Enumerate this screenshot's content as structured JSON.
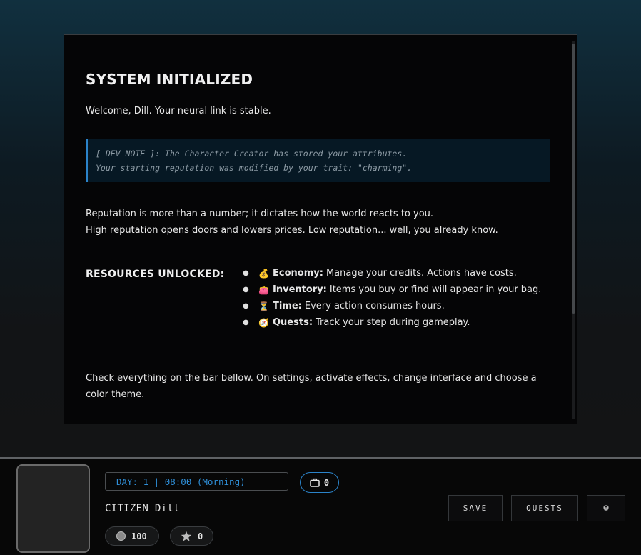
{
  "story": {
    "title": "SYSTEM INITIALIZED",
    "welcome": "Welcome, Dill. Your neural link is stable.",
    "dev_note": {
      "line1": "[ DEV NOTE ]: The Character Creator has stored your attributes.",
      "line2": "Your starting reputation was modified by your trait: \"charming\"."
    },
    "reputation": {
      "line1": "Reputation is more than a number; it dictates how the world reacts to you.",
      "line2": "High reputation opens doors and lowers prices. Low reputation... well, you already know."
    },
    "resources": {
      "label": "RESOURCES UNLOCKED:",
      "items": [
        {
          "emoji": "💰",
          "name": "Economy:",
          "desc": "Manage your credits. Actions have costs."
        },
        {
          "emoji": "👛",
          "name": "Inventory:",
          "desc": "Items you buy or find will appear in your bag."
        },
        {
          "emoji": "⏳",
          "name": "Time:",
          "desc": "Every action consumes hours."
        },
        {
          "emoji": "🧭",
          "name": "Quests:",
          "desc": "Track your step during gameplay."
        }
      ]
    },
    "check": "Check everything on the bar bellow. On settings, activate effects, change interface and choose a color theme."
  },
  "hud": {
    "day_text": "DAY: 1 | 08:00 (Morning)",
    "bag_count": "0",
    "citizen": "CITIZEN Dill",
    "credits": "100",
    "reputation_value": "0",
    "save_label": "SAVE",
    "quests_label": "QUESTS",
    "settings_label": "⚙"
  },
  "colors": {
    "accent": "#2b83c9",
    "day_text": "#2f8fd8",
    "panel_bg": "#050506"
  },
  "icons": {
    "bag": "briefcase-icon",
    "credits": "coin-icon",
    "reputation": "star-icon",
    "settings": "gear-icon"
  }
}
